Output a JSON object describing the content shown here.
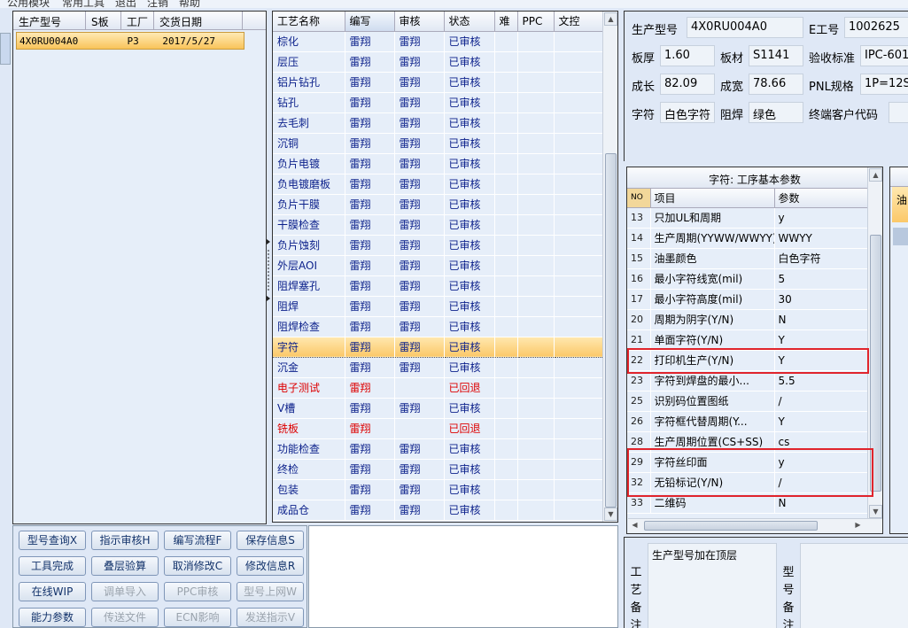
{
  "menu": [
    "公用模块",
    "常用工具",
    "退出",
    "注销",
    "帮助"
  ],
  "product_list": {
    "columns": [
      "生产型号",
      "S板",
      "工厂",
      "交货日期"
    ],
    "rows": [
      {
        "model": "4X0RU004A0",
        "sboard": "",
        "factory": "P3",
        "date": "2017/5/27"
      }
    ]
  },
  "process_table": {
    "columns": [
      "工艺名称",
      "编写",
      "审核",
      "状态",
      "难",
      "PPC",
      "文控"
    ],
    "rows": [
      {
        "name": "棕化",
        "writer": "雷翔",
        "reviewer": "雷翔",
        "status": "已审核"
      },
      {
        "name": "层压",
        "writer": "雷翔",
        "reviewer": "雷翔",
        "status": "已审核"
      },
      {
        "name": "铝片钻孔",
        "writer": "雷翔",
        "reviewer": "雷翔",
        "status": "已审核"
      },
      {
        "name": "钻孔",
        "writer": "雷翔",
        "reviewer": "雷翔",
        "status": "已审核"
      },
      {
        "name": "去毛刺",
        "writer": "雷翔",
        "reviewer": "雷翔",
        "status": "已审核"
      },
      {
        "name": "沉铜",
        "writer": "雷翔",
        "reviewer": "雷翔",
        "status": "已审核"
      },
      {
        "name": "负片电镀",
        "writer": "雷翔",
        "reviewer": "雷翔",
        "status": "已审核"
      },
      {
        "name": "负电镀磨板",
        "writer": "雷翔",
        "reviewer": "雷翔",
        "status": "已审核"
      },
      {
        "name": "负片干膜",
        "writer": "雷翔",
        "reviewer": "雷翔",
        "status": "已审核"
      },
      {
        "name": "干膜检查",
        "writer": "雷翔",
        "reviewer": "雷翔",
        "status": "已审核"
      },
      {
        "name": "负片蚀刻",
        "writer": "雷翔",
        "reviewer": "雷翔",
        "status": "已审核"
      },
      {
        "name": "外层AOI",
        "writer": "雷翔",
        "reviewer": "雷翔",
        "status": "已审核"
      },
      {
        "name": "阻焊塞孔",
        "writer": "雷翔",
        "reviewer": "雷翔",
        "status": "已审核"
      },
      {
        "name": "阻焊",
        "writer": "雷翔",
        "reviewer": "雷翔",
        "status": "已审核"
      },
      {
        "name": "阻焊检查",
        "writer": "雷翔",
        "reviewer": "雷翔",
        "status": "已审核"
      },
      {
        "name": "字符",
        "writer": "雷翔",
        "reviewer": "雷翔",
        "status": "已审核",
        "selected": true
      },
      {
        "name": "沉金",
        "writer": "雷翔",
        "reviewer": "雷翔",
        "status": "已审核"
      },
      {
        "name": "电子测试",
        "writer": "雷翔",
        "reviewer": "",
        "status": "已回退",
        "returned": true
      },
      {
        "name": "V槽",
        "writer": "雷翔",
        "reviewer": "雷翔",
        "status": "已审核"
      },
      {
        "name": "铣板",
        "writer": "雷翔",
        "reviewer": "",
        "status": "已回退",
        "returned": true
      },
      {
        "name": "功能检查",
        "writer": "雷翔",
        "reviewer": "雷翔",
        "status": "已审核"
      },
      {
        "name": "终检",
        "writer": "雷翔",
        "reviewer": "雷翔",
        "status": "已审核"
      },
      {
        "name": "包装",
        "writer": "雷翔",
        "reviewer": "雷翔",
        "status": "已审核"
      },
      {
        "name": "成品仓",
        "writer": "雷翔",
        "reviewer": "雷翔",
        "status": "已审核"
      }
    ]
  },
  "buttons": [
    {
      "label": "型号查询X",
      "enabled": true
    },
    {
      "label": "指示审核H",
      "enabled": true
    },
    {
      "label": "编写流程F",
      "enabled": true
    },
    {
      "label": "保存信息S",
      "enabled": true
    },
    {
      "label": "工具完成",
      "enabled": true
    },
    {
      "label": "叠层验算",
      "enabled": true
    },
    {
      "label": "取消修改C",
      "enabled": true
    },
    {
      "label": "修改信息R",
      "enabled": true
    },
    {
      "label": "在线WIP",
      "enabled": true
    },
    {
      "label": "调单导入",
      "enabled": false
    },
    {
      "label": "PPC审核",
      "enabled": false
    },
    {
      "label": "型号上网W",
      "enabled": false
    },
    {
      "label": "能力参数",
      "enabled": true
    },
    {
      "label": "传送文件",
      "enabled": false
    },
    {
      "label": "ECN影响",
      "enabled": false
    },
    {
      "label": "发送指示V",
      "enabled": false
    }
  ],
  "info": {
    "model_label": "生产型号",
    "model": "4X0RU004A0",
    "e_label": "E工号",
    "e_no": "1002625",
    "thickness_label": "板厚",
    "thickness": "1.60",
    "material_label": "板材",
    "material": "S1141",
    "standard_label": "验收标准",
    "standard": "IPC-601",
    "length_label": "成长",
    "length": "82.09",
    "width_label": "成宽",
    "width": "78.66",
    "pnl_label": "PNL规格",
    "pnl": "1P=12S",
    "char_label": "字符",
    "char": "白色字符",
    "mask_label": "阻焊",
    "mask": "绿色",
    "customer_label": "终端客户代码",
    "customer": ""
  },
  "params": {
    "title": "字符: 工序基本参数",
    "columns": [
      "NO",
      "项目",
      "参数"
    ],
    "rows": [
      {
        "no": "13",
        "item": "只加UL和周期",
        "value": "y"
      },
      {
        "no": "14",
        "item": "生产周期(YYWW/WWYY)",
        "value": "WWYY"
      },
      {
        "no": "15",
        "item": "油墨颜色",
        "value": "白色字符"
      },
      {
        "no": "16",
        "item": "最小字符线宽(mil)",
        "value": "5"
      },
      {
        "no": "17",
        "item": "最小字符高度(mil)",
        "value": "30"
      },
      {
        "no": "20",
        "item": "周期为阴字(Y/N)",
        "value": "N"
      },
      {
        "no": "21",
        "item": "单面字符(Y/N)",
        "value": "Y"
      },
      {
        "no": "22",
        "item": "打印机生产(Y/N)",
        "value": "Y"
      },
      {
        "no": "23",
        "item": "字符到焊盘的最小...",
        "value": "5.5"
      },
      {
        "no": "25",
        "item": "识别码位置图纸",
        "value": "/"
      },
      {
        "no": "26",
        "item": "字符框代替周期(Y...",
        "value": "Y"
      },
      {
        "no": "28",
        "item": "生产周期位置(CS+SS)",
        "value": "cs"
      },
      {
        "no": "29",
        "item": "字符丝印面",
        "value": "y"
      },
      {
        "no": "32",
        "item": "无铅标记(Y/N)",
        "value": "/"
      },
      {
        "no": "33",
        "item": "二维码",
        "value": "N"
      }
    ]
  },
  "sliver": {
    "selected_text": "油"
  },
  "notes": {
    "process_label": "工艺备注",
    "process_note": "生产型号加在顶层",
    "model_label": "型号备注",
    "model_note": ""
  },
  "colors": {
    "selected_row": "#fbc869",
    "approved_text": "#0a1f8a",
    "returned_text": "#dd0000",
    "highlight_box": "#e0242c"
  }
}
